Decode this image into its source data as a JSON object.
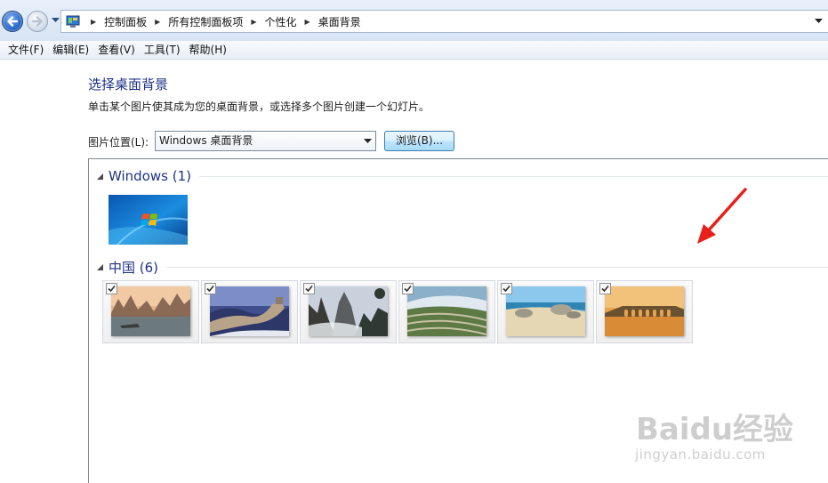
{
  "breadcrumb": [
    "控制面板",
    "所有控制面板项",
    "个性化",
    "桌面背景"
  ],
  "menu": [
    "文件(F)",
    "编辑(E)",
    "查看(V)",
    "工具(T)",
    "帮助(H)"
  ],
  "page": {
    "title": "选择桌面背景",
    "instruction": "单击某个图片使其成为您的桌面背景，或选择多个图片创建一个幻灯片。",
    "location_label": "图片位置(L):",
    "location_value": "Windows 桌面背景",
    "browse_label": "浏览(B)..."
  },
  "groups": [
    {
      "name": "Windows (1)",
      "images": [
        "windows-wallpaper"
      ]
    },
    {
      "name": "中国 (6)",
      "images": [
        "karst-river",
        "great-wall",
        "yellow-mountain",
        "rice-terraces",
        "beach-rocks",
        "seventeen-arch-bridge"
      ],
      "checked": [
        true,
        true,
        true,
        true,
        true,
        true
      ]
    }
  ],
  "watermark": {
    "brand": "Baidu经验",
    "url": "jingyan.baidu.com"
  },
  "colors": {
    "title_blue": "#1e3287",
    "annotation_red": "#e8201c"
  }
}
